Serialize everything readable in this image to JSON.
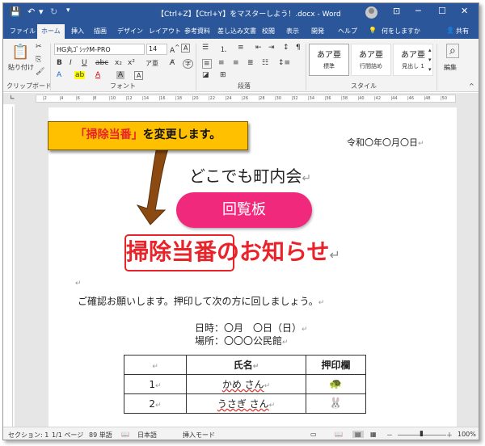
{
  "titlebar": {
    "title": "【Ctrl+Z】【Ctrl+Y】をマスターしよう！.docx  -  Word",
    "save_icon": "save-icon",
    "undo_icon": "undo-icon",
    "redo_icon": "redo-icon",
    "ribbon_display_icon": "ribbon-display-icon",
    "minimize": "─",
    "maximize": "☐",
    "close": "✕"
  },
  "tabs": [
    {
      "label": "ファイル",
      "active": false
    },
    {
      "label": "ホーム",
      "active": true
    },
    {
      "label": "挿入",
      "active": false
    },
    {
      "label": "描画",
      "active": false
    },
    {
      "label": "デザイン",
      "active": false
    },
    {
      "label": "レイアウト",
      "active": false
    },
    {
      "label": "参考資料",
      "active": false
    },
    {
      "label": "差し込み文書",
      "active": false
    },
    {
      "label": "校閲",
      "active": false
    },
    {
      "label": "表示",
      "active": false
    },
    {
      "label": "開発",
      "active": false
    },
    {
      "label": "ヘルプ",
      "active": false
    }
  ],
  "tell_me": "何をしますか",
  "share": "共有",
  "ribbon": {
    "paste_label": "貼り付け",
    "clipboard_group": "クリップボード",
    "font_name": "HG丸ｺﾞｼｯｸM-PRO",
    "font_size": "14",
    "font_group": "フォント",
    "paragraph_group": "段落",
    "style_group": "スタイル",
    "editing_label": "編集",
    "styles": [
      {
        "sample": "あア亜",
        "name": "標準"
      },
      {
        "sample": "あア亜",
        "name": "行間詰め"
      },
      {
        "sample": "あア亜",
        "name": "見出し 1"
      }
    ]
  },
  "document": {
    "date": "令和〇年〇月〇日",
    "organizer": "どこでも町内会",
    "circular_label": "回覧板",
    "headline_highlight": "掃除当番",
    "headline_rest": "のお知らせ",
    "intro": "ご確認お願いします。押印して次の方に回しましょう。",
    "when": "日時：〇月　〇日（日）",
    "where": "場所：〇〇〇公民館",
    "table": {
      "headers": [
        "",
        "氏名",
        "押印欄"
      ],
      "rows": [
        {
          "no": "1",
          "name": "かめ さん",
          "stamp": "turtle-icon"
        },
        {
          "no": "2",
          "name": "うさぎ さん",
          "stamp": "rabbit-icon"
        }
      ]
    }
  },
  "callout": {
    "highlight": "「掃除当番」",
    "rest": "を変更します。"
  },
  "status": {
    "section": "セクション: 1",
    "page": "1/1 ページ",
    "words": "89 単語",
    "language": "日本語",
    "mode": "挿入モード",
    "zoom": "100%"
  },
  "colors": {
    "ribbon_blue": "#2b579a",
    "pill_pink": "#f0297d",
    "headline_red": "#e8232a",
    "callout_yellow": "#ffc000",
    "arrow_brown": "#8b4a12"
  }
}
